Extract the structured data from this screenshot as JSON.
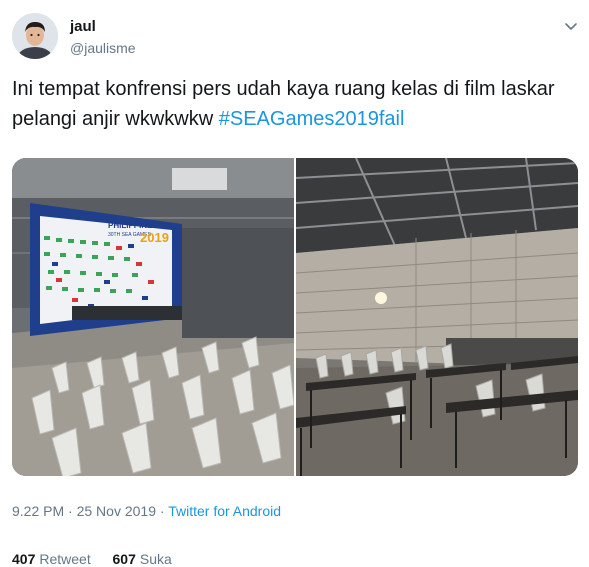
{
  "tweet": {
    "name": "jaul",
    "handle": "@jaulisme",
    "text": "Ini tempat konfrensi pers udah kaya ruang kelas di film laskar pelangi anjir wkwkwkw ",
    "hashtag": "#SEAGames2019fail",
    "time": "9.22 PM",
    "date": "25 Nov 2019",
    "separator": "·",
    "source": "Twitter for Android"
  },
  "photo_left": {
    "banner_line1": "PHILIPPINES",
    "banner_line2": "30TH SEA GAMES",
    "banner_year": "2019"
  },
  "stats": {
    "retweets_count": "407",
    "retweets_label": "Retweet",
    "likes_count": "607",
    "likes_label": "Suka"
  },
  "colors": {
    "link": "#1b95e0",
    "secondary_text": "#657786",
    "primary_text": "#14171a"
  }
}
